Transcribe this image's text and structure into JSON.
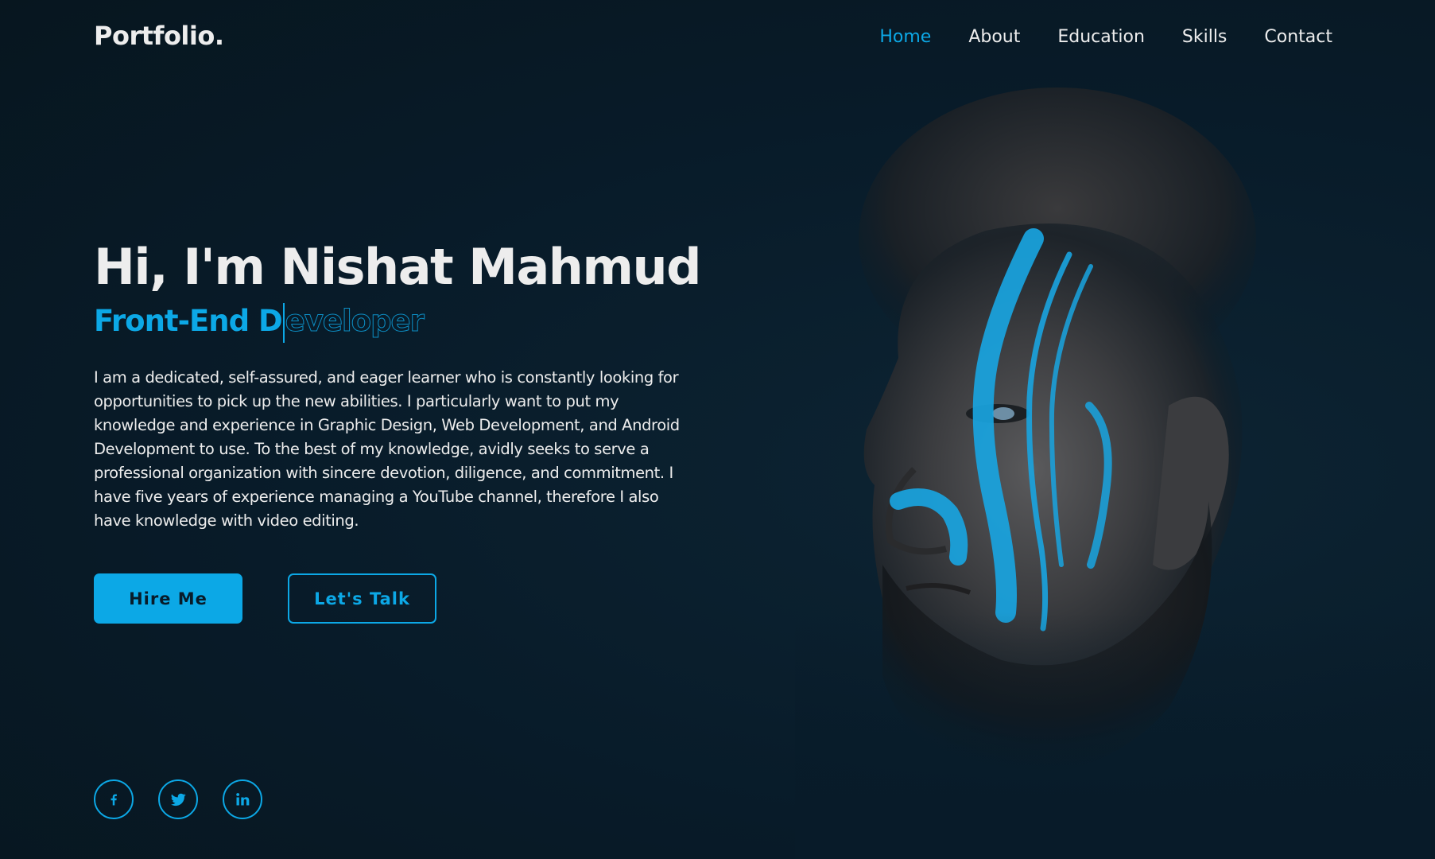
{
  "header": {
    "logo": "Portfolio.",
    "nav": [
      {
        "label": "Home",
        "active": true
      },
      {
        "label": "About",
        "active": false
      },
      {
        "label": "Education",
        "active": false
      },
      {
        "label": "Skills",
        "active": false
      },
      {
        "label": "Contact",
        "active": false
      }
    ]
  },
  "hero": {
    "title": "Hi, I'm Nishat Mahmud",
    "role_filled": "Front-End D",
    "role_outline": "eveloper",
    "description": "I am a dedicated, self-assured, and eager learner who is constantly looking for opportunities to pick up the new abilities. I particularly want to put my knowledge and experience in Graphic Design, Web Development, and Android Development to use. To the best of my knowledge, avidly seeks to serve a professional organization with sincere devotion, diligence, and commitment. I have five years of experience managing a YouTube channel, therefore I also have knowledge with video editing.",
    "buttons": {
      "primary": "Hire Me",
      "secondary": "Let's Talk"
    }
  },
  "social": [
    {
      "icon": "facebook-icon"
    },
    {
      "icon": "twitter-icon"
    },
    {
      "icon": "linkedin-icon"
    }
  ],
  "colors": {
    "background": "#081b29",
    "accent": "#0ca8e6",
    "text": "#ededed"
  }
}
